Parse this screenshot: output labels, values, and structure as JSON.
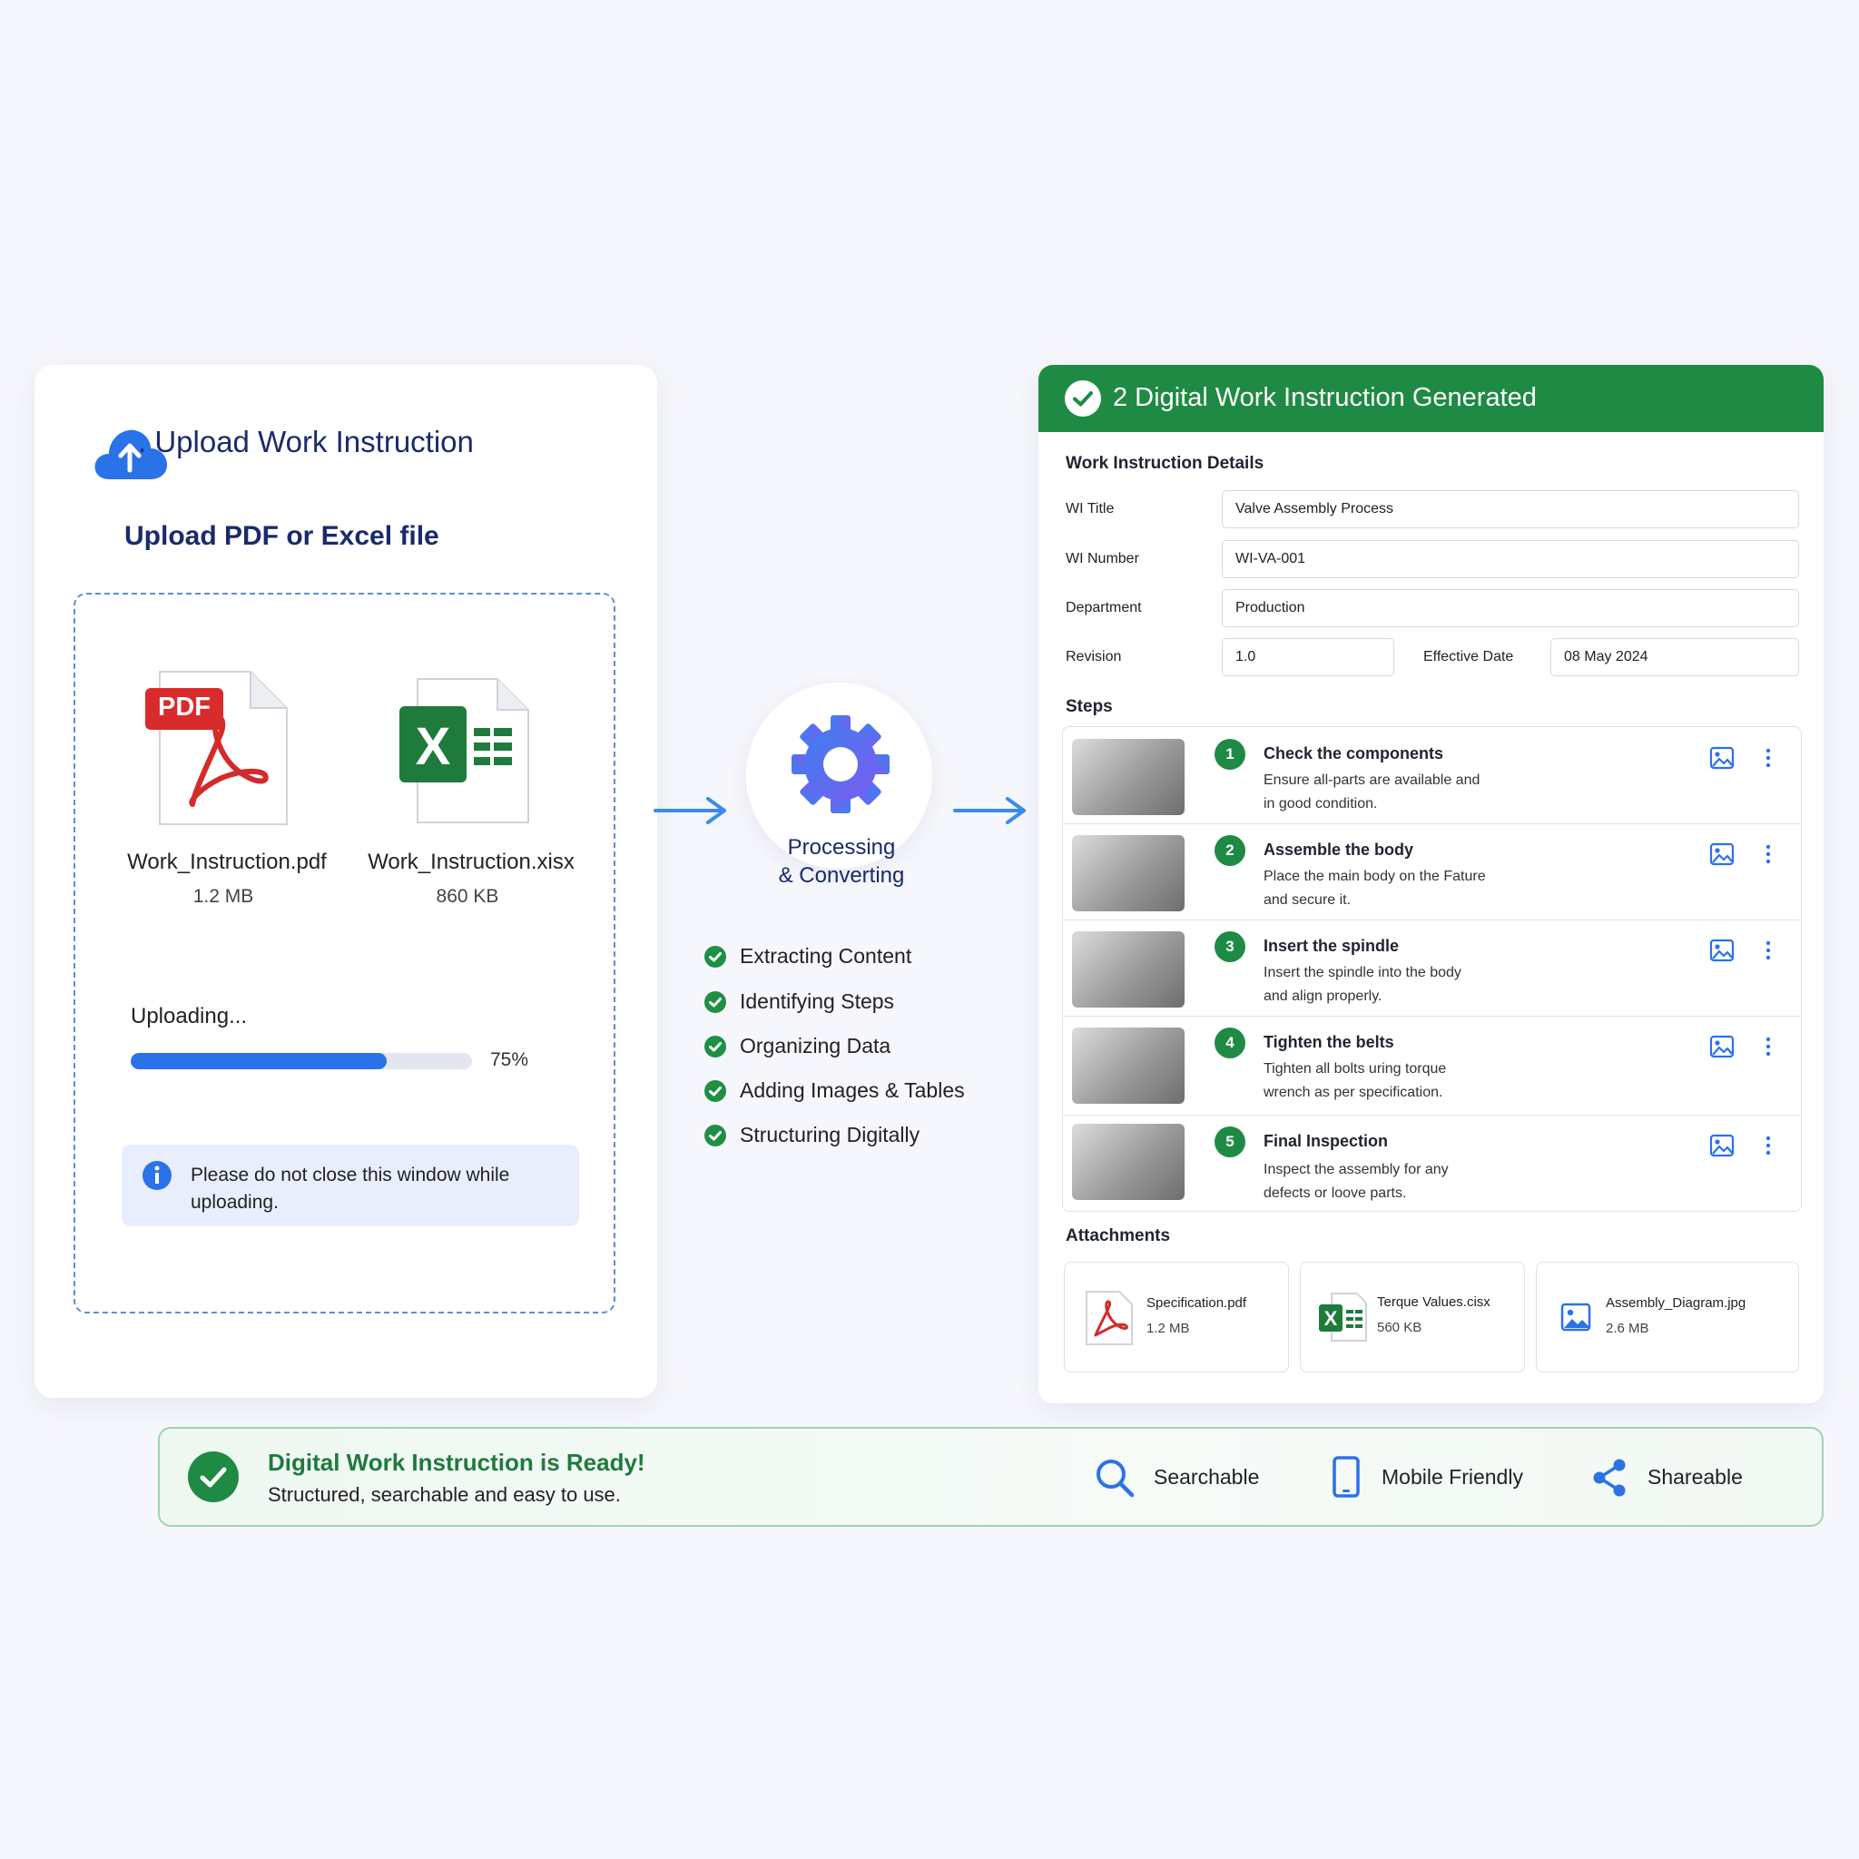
{
  "upload": {
    "title": ". Upload Work Instruction",
    "subtitle": "Upload PDF or Excel file",
    "pdf_badge": "PDF",
    "files": [
      {
        "name": "Work_Instruction.pdf",
        "size": "1.2 MB",
        "icon": "pdf-file-icon"
      },
      {
        "name": "Work_Instruction.xisx",
        "size": "860 KB",
        "icon": "excel-file-icon"
      }
    ],
    "status": "Uploading...",
    "progress_percent_label": "75%",
    "progress_value": 0.75,
    "notice_icon": "info-icon",
    "notice": "Please do not close this window while uploading."
  },
  "process": {
    "icon": "gear-icon",
    "label_line1": "Processing",
    "label_line2": "& Converting",
    "steps": [
      "Extracting Content",
      "Identifying Steps",
      "Organizing Data",
      "Adding Images & Tables",
      "Structuring Digitally"
    ]
  },
  "result": {
    "header": "2 Digital Work Instruction Generated",
    "details_label": "Work Instruction Details",
    "fields": {
      "wi_title_label": "WI Title",
      "wi_title": "Valve Assembly Process",
      "wi_number_label": "WI Number",
      "wi_number": "WI-VA-001",
      "department_label": "Department",
      "department": "Production",
      "revision_label": "Revision",
      "revision": "1.0",
      "effective_date_label": "Effective Date",
      "effective_date": "08 May 2024"
    },
    "steps_label": "Steps",
    "steps": [
      {
        "num": "1",
        "title": "Check the components",
        "line1": "Ensure all-parts are available and",
        "line2": "in good condition."
      },
      {
        "num": "2",
        "title": "Assemble the body",
        "line1": "Place the main body on the Fature",
        "line2": "and secure it."
      },
      {
        "num": "3",
        "title": "Insert the spindle",
        "line1": "Insert the spindle into the body",
        "line2": "and align properly."
      },
      {
        "num": "4",
        "title": "Tighten the belts",
        "line1": "Tighten all bolts uring torque",
        "line2": "wrench as per specification."
      },
      {
        "num": "5",
        "title": "Final Inspection",
        "line1": "Inspect the assembly for any",
        "line2": "defects or loove parts."
      }
    ],
    "attachments_label": "Attachments",
    "attachments": [
      {
        "name": "Specification.pdf",
        "size": "1.2 MB",
        "icon": "pdf-icon"
      },
      {
        "name": "Terque Values.cisx",
        "size": "560 KB",
        "icon": "excel-icon"
      },
      {
        "name": "Assembly_Diagram.jpg",
        "size": "2.6 MB",
        "icon": "image-icon"
      }
    ]
  },
  "ready": {
    "title": "Digital Work Instruction is Ready!",
    "subtitle": "Structured, searchable and easy to use.",
    "features": [
      {
        "label": "Searchable",
        "icon": "search-icon"
      },
      {
        "label": "Mobile Friendly",
        "icon": "mobile-icon"
      },
      {
        "label": "Shareable",
        "icon": "share-icon"
      }
    ]
  },
  "colors": {
    "accent_blue": "#2a72e8",
    "accent_green": "#1f8a43",
    "navy_text": "#1a2a6c"
  }
}
